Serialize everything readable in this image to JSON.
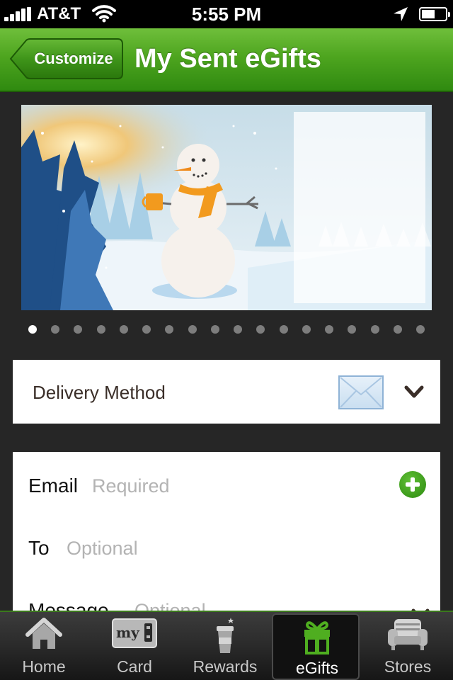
{
  "status_bar": {
    "carrier": "AT&T",
    "time": "5:55 PM",
    "icons": [
      "signal-icon",
      "wifi-icon",
      "location-arrow-icon",
      "battery-icon"
    ],
    "battery_level": 0.55
  },
  "nav": {
    "back_label": "Customize",
    "title": "My Sent eGifts",
    "color": "#4ea51f"
  },
  "gallery": {
    "page_count": 18,
    "current_page": 1
  },
  "delivery": {
    "label": "Delivery Method",
    "selected_icon": "envelope-icon",
    "expand_icon": "chevron-down-icon"
  },
  "form": {
    "email": {
      "label": "Email",
      "placeholder": "Required"
    },
    "to": {
      "label": "To",
      "placeholder": "Optional"
    },
    "message": {
      "label": "Message",
      "placeholder": "Optional"
    }
  },
  "tabs": [
    {
      "label": "Home",
      "icon": "home-icon"
    },
    {
      "label": "Card",
      "icon": "my-card-icon"
    },
    {
      "label": "Rewards",
      "icon": "cup-icon"
    },
    {
      "label": "eGifts",
      "icon": "gift-icon",
      "selected": true
    },
    {
      "label": "Stores",
      "icon": "armchair-icon"
    }
  ],
  "colors": {
    "accent_green": "#3f9a1a",
    "background": "#262626",
    "placeholder": "#b3b3b3"
  }
}
